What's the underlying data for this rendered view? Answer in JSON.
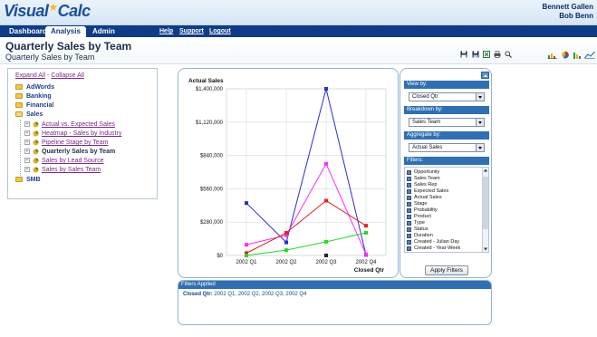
{
  "app": {
    "logo_part1": "Visual",
    "logo_part2": "Calc",
    "user_line1": "Bennett Gallen",
    "user_line2": "Bob Benn"
  },
  "nav": {
    "tabs": [
      {
        "label": "Dashboard",
        "active": false
      },
      {
        "label": "Analysis",
        "active": true
      },
      {
        "label": "Admin",
        "active": false
      }
    ],
    "links": [
      "Help",
      "Support",
      "Logout"
    ]
  },
  "page": {
    "title": "Quarterly Sales by Team",
    "subtitle": "Quarterly Sales by Team",
    "toolbar_icons": [
      "save-icon",
      "save-as-icon",
      "excel-export-icon",
      "print-icon",
      "zoom-icon"
    ],
    "chart_type_icons": [
      "bar-chart-icon",
      "pie-chart-icon",
      "column-chart-icon",
      "line-chart-icon"
    ]
  },
  "tree": {
    "expand_all": "Expand All",
    "separator": " - ",
    "collapse_all": "Collapse All",
    "folders": [
      "AdWords",
      "Banking",
      "Financial",
      "Sales",
      "SMB"
    ],
    "reports": [
      {
        "label": "Actual vs. Expected Sales",
        "current": false
      },
      {
        "label": "Heatmap - Sales by Industry",
        "current": false
      },
      {
        "label": "Pipeline Stage by Team",
        "current": false
      },
      {
        "label": "Quarterly Sales by Team",
        "current": true
      },
      {
        "label": "Sales by Lead Source",
        "current": false
      },
      {
        "label": "Sales by Sales Team",
        "current": false
      }
    ]
  },
  "filters": {
    "view_by_label": "View by:",
    "view_by_value": "Closed Qtr",
    "breakdown_label": "Breakdown by:",
    "breakdown_value": "Sales Team",
    "aggregate_label": "Aggregate by:",
    "aggregate_value": "Actual Sales",
    "filters_label": "Filters:",
    "filter_items": [
      "Opportunity",
      "Sales Team",
      "Sales Rep",
      "Expected Sales",
      "Actual Sales",
      "Stage",
      "Probability",
      "Product",
      "Type",
      "Status",
      "Duration",
      "Created - Julian Day",
      "Created - Year-Week"
    ],
    "apply_button": "Apply Filters"
  },
  "applied": {
    "header": "Filters Applied",
    "key": "Closed Qtr:",
    "value": " 2002 Q1, 2002 Q2, 2002 Q3, 2002 Q4"
  },
  "colors": {
    "nav_bg": "#0f3c88",
    "panel_border": "#8fb3d6",
    "section_header": "#2f70b4"
  },
  "chart_data": {
    "type": "line",
    "ylabel": "Actual Sales",
    "xlabel": "Closed Qtr",
    "categories": [
      "2002 Q1",
      "2002 Q2",
      "2002 Q3",
      "2002 Q4"
    ],
    "ylim": [
      0,
      1400000
    ],
    "y_ticks": [
      0,
      280000,
      560000,
      840000,
      1120000,
      1400000
    ],
    "y_tick_labels": [
      "$0",
      "$280,000",
      "$560,000",
      "$840,000",
      "$1,120,000",
      "$1,400,000"
    ],
    "grid": true,
    "legend": "none",
    "series": [
      {
        "color": "#2b2bd6",
        "values": [
          440000,
          110000,
          1400000,
          5000
        ]
      },
      {
        "color": "#ff2cff",
        "values": [
          90000,
          170000,
          770000,
          10000
        ]
      },
      {
        "color": "#e82020",
        "values": [
          20000,
          190000,
          460000,
          250000
        ]
      },
      {
        "color": "#22dd22",
        "values": [
          0,
          45000,
          115000,
          190000
        ]
      },
      {
        "color": "#222222",
        "values": [
          null,
          null,
          0,
          null
        ]
      }
    ]
  }
}
